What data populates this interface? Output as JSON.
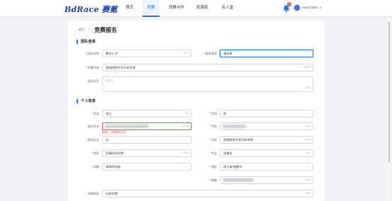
{
  "header": {
    "logo": "BdRace 赛氪",
    "nav": [
      "首页",
      "竞赛",
      "竞赛合作",
      "资源库",
      "名人堂"
    ],
    "active_nav": "竞赛",
    "notification_count": "0",
    "username": "useru72km",
    "colors": {
      "brand": "#1a3fa8",
      "accent": "#1677ff",
      "error": "#ff4d4f"
    }
  },
  "page": {
    "back": "← 返回",
    "title": "竞赛报名"
  },
  "team_section": {
    "title": "团队信息",
    "team_name": {
      "label": "团队名称",
      "value": "数学人才",
      "count": "4/70"
    },
    "advisor": {
      "label": "指导老师",
      "placeholder": "请选择"
    },
    "school": {
      "label": "所属学校",
      "value": "西南财经大学天府学院",
      "count": "10/30"
    },
    "slogan": {
      "label": "团队口号",
      "placeholder": "请输入",
      "count": "0/30"
    }
  },
  "personal_section": {
    "title": "个人信息",
    "name": {
      "label": "姓名",
      "value": "张三",
      "count": "2/20"
    },
    "gender": {
      "label": "性别",
      "value": "男"
    },
    "id_number": {
      "label": "身份证号",
      "count": "18/18",
      "error": "请输入正确身份证号"
    },
    "phone": {
      "label": "手机",
      "count": "11/11"
    },
    "is_leader": {
      "label": "是否队长",
      "value": "否"
    },
    "school": {
      "label": "学校",
      "value": "西南财经大学天府学院",
      "count": "10/30"
    },
    "college": {
      "label": "院系",
      "value": "互联网学学院",
      "count": "6/30"
    },
    "major": {
      "label": "专业",
      "value": "金融学",
      "count": "3/30"
    },
    "grade": {
      "label": "年级",
      "value": "本科四年级"
    },
    "region": {
      "label": "地区",
      "value": "四川省/成都市"
    },
    "email": {
      "label": "邮箱",
      "count": "17/30"
    },
    "address": {
      "label": "详细地址",
      "value": "天府学院",
      "count": "4/50"
    }
  }
}
